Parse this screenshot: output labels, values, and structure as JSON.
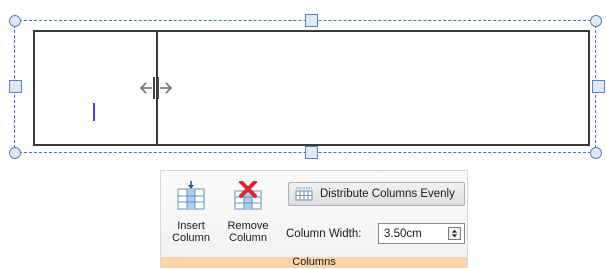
{
  "ribbon": {
    "group_label": "Columns",
    "insert_column": {
      "line1": "Insert",
      "line2": "Column",
      "icon": "insert-column-icon"
    },
    "remove_column": {
      "line1": "Remove",
      "line2": "Column",
      "icon": "remove-column-icon"
    },
    "distribute_label": "Distribute Columns Evenly",
    "distribute_icon": "distribute-columns-icon",
    "column_width_label": "Column Width:",
    "column_width_value": "3.50cm"
  },
  "colors": {
    "selection_frame": "#4a6fb5",
    "table_border": "#3a3a3a",
    "text_cursor": "#4b3fdc",
    "remove_x": "#e0242b",
    "group_bar": "#f8d3a6"
  }
}
